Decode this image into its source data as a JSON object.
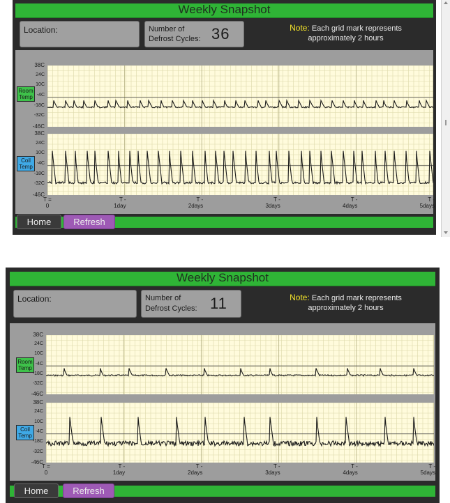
{
  "snapshots": [
    {
      "title": "Weekly Snapshot",
      "location_label": "Location:",
      "cycles_label_line1": "Number of",
      "cycles_label_line2": "Defrost Cycles:",
      "cycles_value": "36",
      "note_word": "Note:",
      "note_line1": "Each grid mark represents",
      "note_line2": "approximately 2 hours",
      "room_tag_line1": "Room",
      "room_tag_line2": "Temp",
      "coil_tag_line1": "Coil",
      "coil_tag_line2": "Temp",
      "y_ticks": [
        "38C",
        "24C",
        "10C",
        "-4C",
        "-18C",
        "-32C",
        "-46C"
      ],
      "x_ticks": [
        {
          "line1": "T =",
          "line2": "0"
        },
        {
          "line1": "T -",
          "line2": "1day"
        },
        {
          "line1": "T -",
          "line2": "2days"
        },
        {
          "line1": "T -",
          "line2": "3days"
        },
        {
          "line1": "T -",
          "line2": "4days"
        },
        {
          "line1": "T -",
          "line2": "5days"
        }
      ],
      "home_label": "Home",
      "refresh_label": "Refresh"
    },
    {
      "title": "Weekly Snapshot",
      "location_label": "Location:",
      "cycles_label_line1": "Number of",
      "cycles_label_line2": "Defrost Cycles:",
      "cycles_value": "11",
      "note_word": "Note:",
      "note_line1": "Each grid mark represents",
      "note_line2": "approximately 2 hours",
      "room_tag_line1": "Room",
      "room_tag_line2": "Temp",
      "coil_tag_line1": "Coil",
      "coil_tag_line2": "Temp",
      "y_ticks": [
        "38C",
        "24C",
        "10C",
        "-4C",
        "-18C",
        "-32C",
        "-46C"
      ],
      "x_ticks": [
        {
          "line1": "T =",
          "line2": "0"
        },
        {
          "line1": "T -",
          "line2": "1day"
        },
        {
          "line1": "T -",
          "line2": "2days"
        },
        {
          "line1": "T -",
          "line2": "3days"
        },
        {
          "line1": "T -",
          "line2": "4days"
        },
        {
          "line1": "T -",
          "line2": "5days"
        }
      ],
      "home_label": "Home",
      "refresh_label": "Refresh"
    }
  ],
  "colors": {
    "title_bar": "#2fb436",
    "panel": "#2b2b2b",
    "graph_bg": "#fffbdc",
    "grid": "#d9d6a8",
    "trace": "#1a1a1a",
    "note_word": "#f2e22a",
    "room_tag": "#3ec24a",
    "coil_tag": "#3fa9e6",
    "refresh_button": "#9e5ab5"
  },
  "icons": [
    "scroll-up-arrow-icon",
    "scroll-down-arrow-icon"
  ]
}
